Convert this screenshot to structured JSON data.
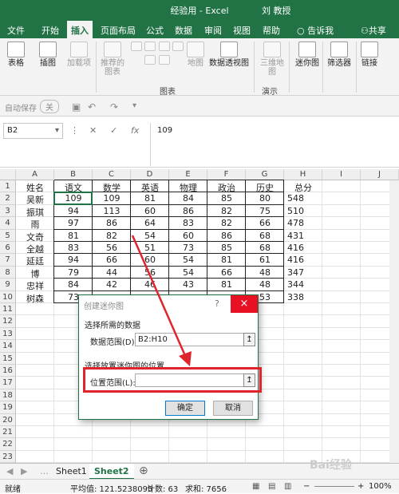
{
  "window": {
    "title": "经验用 - Excel",
    "user": "刘 教授"
  },
  "tabs": [
    "文件",
    "开始",
    "插入",
    "页面布局",
    "公式",
    "数据",
    "审阅",
    "视图",
    "帮助",
    "告诉我",
    "共享"
  ],
  "ribbon": {
    "groups": [
      {
        "label": "表格",
        "disabled": false
      },
      {
        "label": "插图",
        "disabled": false
      },
      {
        "label": "加载项",
        "disabled": true
      },
      {
        "label": "推荐的图表",
        "disabled": true
      },
      {
        "label": "地图",
        "disabled": true
      },
      {
        "label": "数据透视图",
        "disabled": false
      },
      {
        "label": "三维地图",
        "disabled": true
      },
      {
        "label": "迷你图",
        "disabled": false
      },
      {
        "label": "筛选器",
        "disabled": false
      },
      {
        "label": "链接",
        "disabled": false
      }
    ],
    "group_labels": [
      "图表",
      "演示"
    ]
  },
  "qat": {
    "autosave": "自动保存",
    "toggle": "关"
  },
  "formula": {
    "namebox": "B2",
    "value": "109",
    "fx": "fx"
  },
  "columns": [
    "A",
    "B",
    "C",
    "D",
    "E",
    "F",
    "G",
    "H",
    "I",
    "J"
  ],
  "rows": [
    "1",
    "2",
    "3",
    "4",
    "5",
    "6",
    "7",
    "8",
    "9",
    "10",
    "11",
    "12",
    "13",
    "14",
    "15",
    "16",
    "17",
    "18",
    "19",
    "20",
    "21",
    "22",
    "23"
  ],
  "table": {
    "headers": [
      "姓名",
      "语文",
      "数学",
      "英语",
      "物理",
      "政治",
      "历史",
      "总分"
    ],
    "data": [
      [
        "吴新",
        "109",
        "109",
        "81",
        "84",
        "85",
        "80",
        "548"
      ],
      [
        "振琪",
        "94",
        "113",
        "60",
        "86",
        "82",
        "75",
        "510"
      ],
      [
        "雨",
        "97",
        "86",
        "64",
        "83",
        "82",
        "66",
        "478"
      ],
      [
        "文奇",
        "81",
        "82",
        "54",
        "60",
        "86",
        "68",
        "431"
      ],
      [
        "全越",
        "83",
        "56",
        "51",
        "73",
        "85",
        "68",
        "416"
      ],
      [
        "延廷",
        "94",
        "66",
        "60",
        "54",
        "81",
        "61",
        "416"
      ],
      [
        "博",
        "79",
        "44",
        "56",
        "54",
        "66",
        "48",
        "347"
      ],
      [
        "忠祥",
        "84",
        "42",
        "46",
        "43",
        "81",
        "48",
        "344"
      ],
      [
        "树森",
        "73",
        "",
        "",
        "",
        "",
        "53",
        "338"
      ]
    ]
  },
  "dialog": {
    "title": "创建迷你图",
    "help": "?",
    "close": "×",
    "section1": "选择所需的数据",
    "range_label": "数据范围(D):",
    "range_value": "B2:H10",
    "section2": "选择放置迷你图的位置",
    "location_label": "位置范围(L):",
    "location_value": "",
    "ok": "确定",
    "cancel": "取消",
    "pick": "↥"
  },
  "sheets": [
    "Sheet1",
    "Sheet2"
  ],
  "status": {
    "mode": "就绪",
    "average": "平均值: 121.5238095",
    "count": "计数: 63",
    "sum": "求和: 7656",
    "zoom": "100%"
  },
  "colors": {
    "brand": "#217346",
    "highlight": "#e0242b"
  }
}
